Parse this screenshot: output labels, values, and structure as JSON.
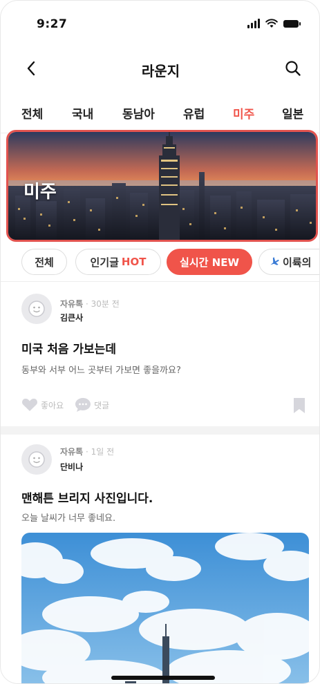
{
  "status_bar": {
    "time": "9:27"
  },
  "header": {
    "title": "라운지"
  },
  "region_tabs": [
    {
      "label": "전체",
      "active": false
    },
    {
      "label": "국내",
      "active": false
    },
    {
      "label": "동남아",
      "active": false
    },
    {
      "label": "유럽",
      "active": false
    },
    {
      "label": "미주",
      "active": true
    },
    {
      "label": "일본",
      "active": false
    }
  ],
  "banner": {
    "label": "미주"
  },
  "filter_chips": [
    {
      "label": "전체",
      "suffix": "",
      "active": false
    },
    {
      "label": "인기글",
      "suffix": "HOT",
      "active": false
    },
    {
      "label": "실시간 NEW",
      "suffix": "",
      "active": true
    },
    {
      "label": "이륙의 ",
      "suffix": "",
      "active": false,
      "icon": "airplane-icon"
    }
  ],
  "posts": [
    {
      "category": "자유톡",
      "time": "· 30분 전",
      "author": "김큰사",
      "title": "미국 처음 가보는데",
      "body": "동부와 서부 어느 곳부터 가보면 좋을까요?",
      "like_label": "좋아요",
      "comment_label": "댓글"
    },
    {
      "category": "자유톡",
      "time": "· 1일 전",
      "author": "단비나",
      "title": "맨해튼 브리지 사진입니다.",
      "body": "오늘 날씨가 너무 좋네요."
    }
  ],
  "colors": {
    "accent": "#f0544a",
    "highlight_border": "#e2534f"
  }
}
